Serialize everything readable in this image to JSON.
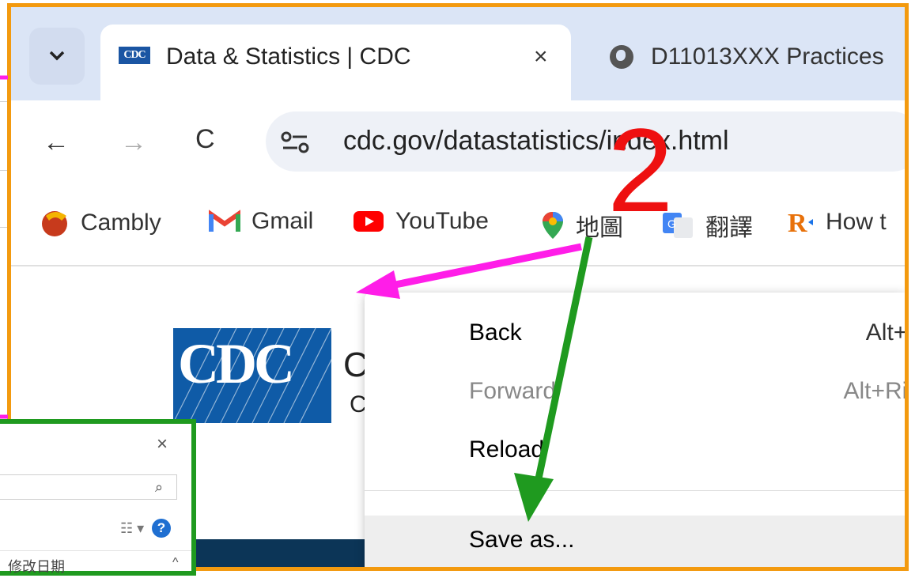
{
  "browser": {
    "active_tab": {
      "favicon_text": "CDC",
      "title": "Data & Statistics | CDC",
      "close": "×"
    },
    "second_tab": {
      "title": "D11013XXX Practices"
    },
    "url": "cdc.gov/datastatistics/index.html",
    "nav": {
      "back": "←",
      "forward": "→",
      "reload": "C"
    }
  },
  "bookmarks": [
    {
      "label": "Cambly",
      "icon": "cambly-icon"
    },
    {
      "label": "Gmail",
      "icon": "gmail-icon"
    },
    {
      "label": "YouTube",
      "icon": "youtube-icon"
    },
    {
      "label": "地圖",
      "icon": "maps-pin-icon"
    },
    {
      "label": "翻譯",
      "icon": "translate-icon"
    },
    {
      "label": "How t",
      "icon": "r-icon"
    }
  ],
  "page": {
    "logo_text": "CDC",
    "org_name": "C",
    "org_name_2": "C"
  },
  "context_menu": {
    "items": [
      {
        "label": "Back",
        "shortcut": "Alt+L",
        "disabled": false
      },
      {
        "label": "Forward",
        "shortcut": "Alt+Rig",
        "disabled": true
      },
      {
        "label": "Reload",
        "shortcut": "",
        "disabled": false
      },
      {
        "label": "Save as...",
        "shortcut": "",
        "disabled": false
      }
    ]
  },
  "explorer": {
    "close": "×",
    "search_icon": "⌕",
    "view_icon": "☷ ▾",
    "help": "?",
    "column_header": "修改日期",
    "scroll_up": "^"
  },
  "annotation": {
    "number": "2"
  },
  "colors": {
    "frame": "#f39a0f",
    "arrow_magenta": "#ff1de8",
    "arrow_green": "#1f9a1f",
    "number_red": "#ee1010",
    "explorer_border": "#1f9a1f"
  }
}
